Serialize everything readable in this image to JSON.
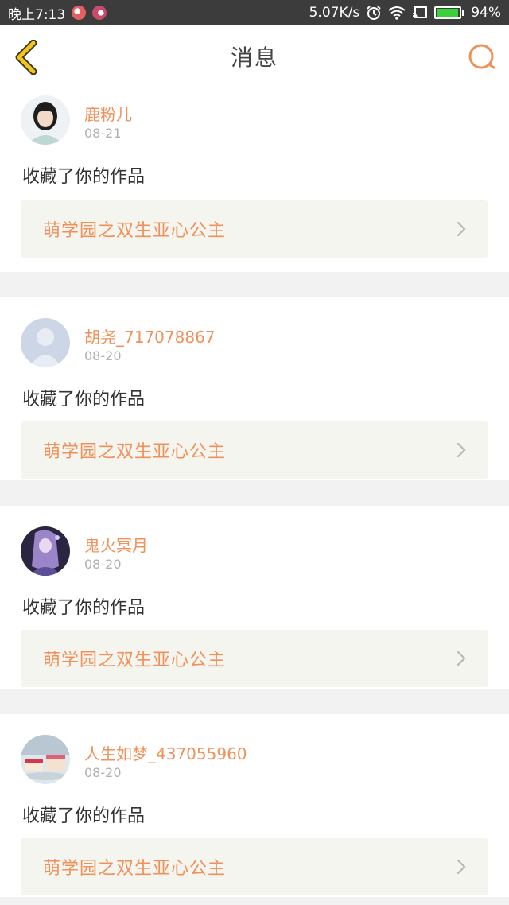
{
  "status_bar": {
    "time": "晚上7:13",
    "speed": "5.07K/s",
    "battery": "94%",
    "battery_level": 0.94,
    "icons": [
      "app-notification-icon",
      "app-notification-icon-2",
      "alarm-icon",
      "wifi-icon",
      "cast-icon",
      "battery-icon"
    ]
  },
  "header": {
    "title": "消息",
    "back_icon": "chevron-left-icon",
    "search_icon": "search-icon"
  },
  "colors": {
    "accent": "#f0915a",
    "back_icon": "#f5c518",
    "card_bg": "#ffffff",
    "work_bg": "#f5f5ef",
    "page_bg": "#f2f2f2"
  },
  "messages": [
    {
      "user": "鹿粉儿",
      "date": "08-21",
      "action": "收藏了你的作品",
      "work": "萌学园之双生亚心公主",
      "avatar": "avatar-girl"
    },
    {
      "user": "胡尧_717078867",
      "date": "08-20",
      "action": "收藏了你的作品",
      "work": "萌学园之双生亚心公主",
      "avatar": "avatar-default"
    },
    {
      "user": "鬼火冥月",
      "date": "08-20",
      "action": "收藏了你的作品",
      "work": "萌学园之双生亚心公主",
      "avatar": "avatar-anime"
    },
    {
      "user": "人生如梦_437055960",
      "date": "08-20",
      "action": "收藏了你的作品",
      "work": "萌学园之双生亚心公主",
      "avatar": "avatar-cake"
    }
  ]
}
